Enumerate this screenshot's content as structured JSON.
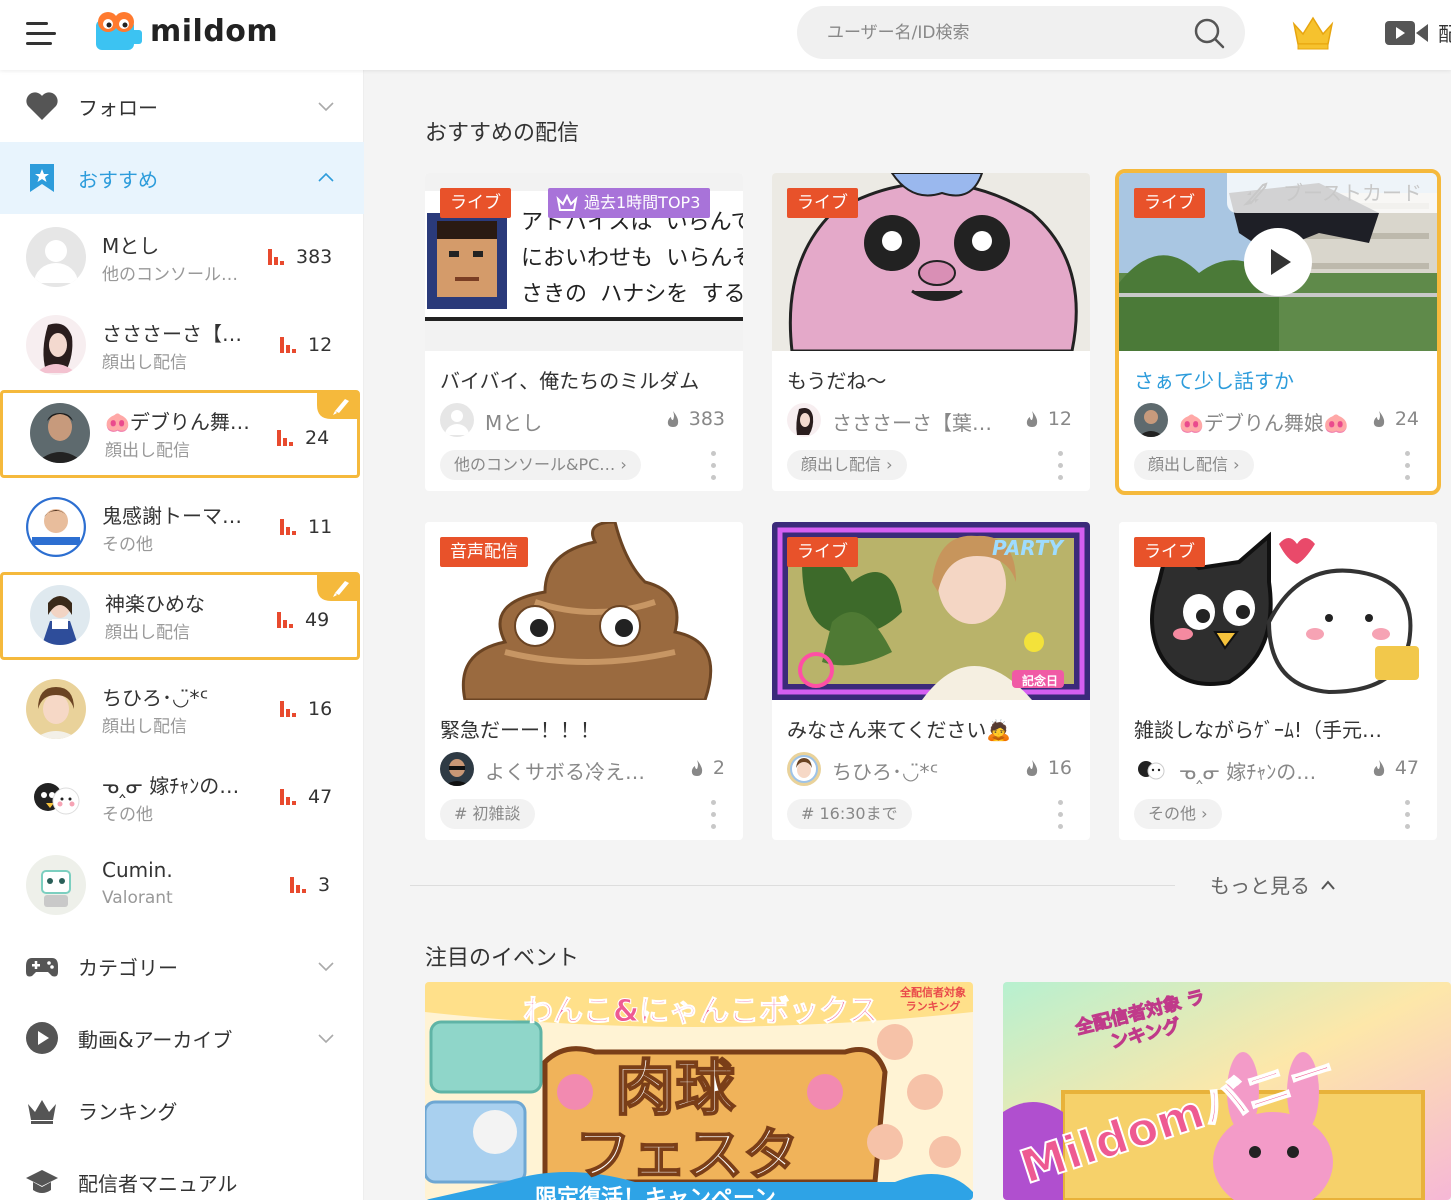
{
  "header": {
    "logo_text": "mildom",
    "search_placeholder": "ユーザー名/ID検索",
    "video_label": "配"
  },
  "sidebar": {
    "follow": "フォロー",
    "recommended": "おすすめ",
    "streamers": [
      {
        "name": "Mとし",
        "category": "他のコンソール…",
        "viewers": "383",
        "boosted": false
      },
      {
        "name": "さささーさ【…",
        "category": "顔出し配信",
        "viewers": "12",
        "boosted": false
      },
      {
        "name": "🐽デブりん舞…",
        "category": "顔出し配信",
        "viewers": "24",
        "boosted": true
      },
      {
        "name": "鬼感謝トーマ…",
        "category": "その他",
        "viewers": "11",
        "boosted": false
      },
      {
        "name": "神楽ひめな",
        "category": "顔出し配信",
        "viewers": "49",
        "boosted": true
      },
      {
        "name": "ちひろ･◡̈*ᑦ",
        "category": "顔出し配信",
        "viewers": "16",
        "boosted": false
      },
      {
        "name": "ᓀ‸ᓂ 嫁ﾁｬﾝの…",
        "category": "その他",
        "viewers": "47",
        "boosted": false
      },
      {
        "name": "Cumin.",
        "category": "Valorant",
        "viewers": "3",
        "boosted": false
      }
    ],
    "category": "カテゴリー",
    "videos": "動画&アーカイブ",
    "ranking": "ランキング",
    "manual": "配信者マニュアル"
  },
  "main": {
    "recommended_title": "おすすめの配信",
    "cards": [
      {
        "tag": "ライブ",
        "badge": "過去1時間TOP3",
        "title": "バイバイ、俺たちのミルダム",
        "user": "Mとし",
        "count": "383",
        "category": "他のコンソール&PC…",
        "category_kind": "link",
        "thumb_text": [
          "アドバイスは いらんて",
          "においわせも いらんぞ",
          "さきの ハナシを するなよ"
        ]
      },
      {
        "tag": "ライブ",
        "title": "もうだね〜",
        "user": "さささーさ【葉…",
        "count": "12",
        "category": "顔出し配信",
        "category_kind": "link"
      },
      {
        "tag": "ライブ",
        "boost": "ブーストカード",
        "title": "さぁて少し話すか",
        "user": "🐽デブりん舞娘🐽",
        "count": "24",
        "category": "顔出し配信",
        "category_kind": "link"
      },
      {
        "tag": "音声配信",
        "title": "緊急だーー！！！",
        "user": "よくサボる冷え…",
        "count": "2",
        "category": "# 初雑談",
        "category_kind": "hashtag"
      },
      {
        "tag": "ライブ",
        "title": "みなさん来てください🙇",
        "user": "ちひろ･◡̈*ᑦ",
        "count": "16",
        "category": "# 16:30まで",
        "category_kind": "hashtag",
        "thumb_party": "PARTY",
        "thumb_badge": "記念日"
      },
      {
        "tag": "ライブ",
        "title": "雑談しながらｹﾞｰﾑ!（手元…",
        "user": "ᓀ‸ᓂ 嫁ﾁｬﾝの…",
        "count": "47",
        "category": "その他",
        "category_kind": "link"
      }
    ],
    "more": "もっと見る",
    "events_title": "注目のイベント",
    "events": [
      {
        "line1": "わんこ&にゃんこボックス",
        "line2": "肉球",
        "line3": "フェスタ",
        "corner": "全配信者対象 ランキング",
        "bottom": "限定復活！キャンペーン"
      },
      {
        "corner": "全配信者対象 ランキング",
        "title": "Mildomバニー"
      }
    ]
  },
  "colors": {
    "accent": "#2d9cdb",
    "live": "#e8522a",
    "boost": "#f5b93c",
    "top3": "#a873d9",
    "bars": "#e84a2e"
  }
}
